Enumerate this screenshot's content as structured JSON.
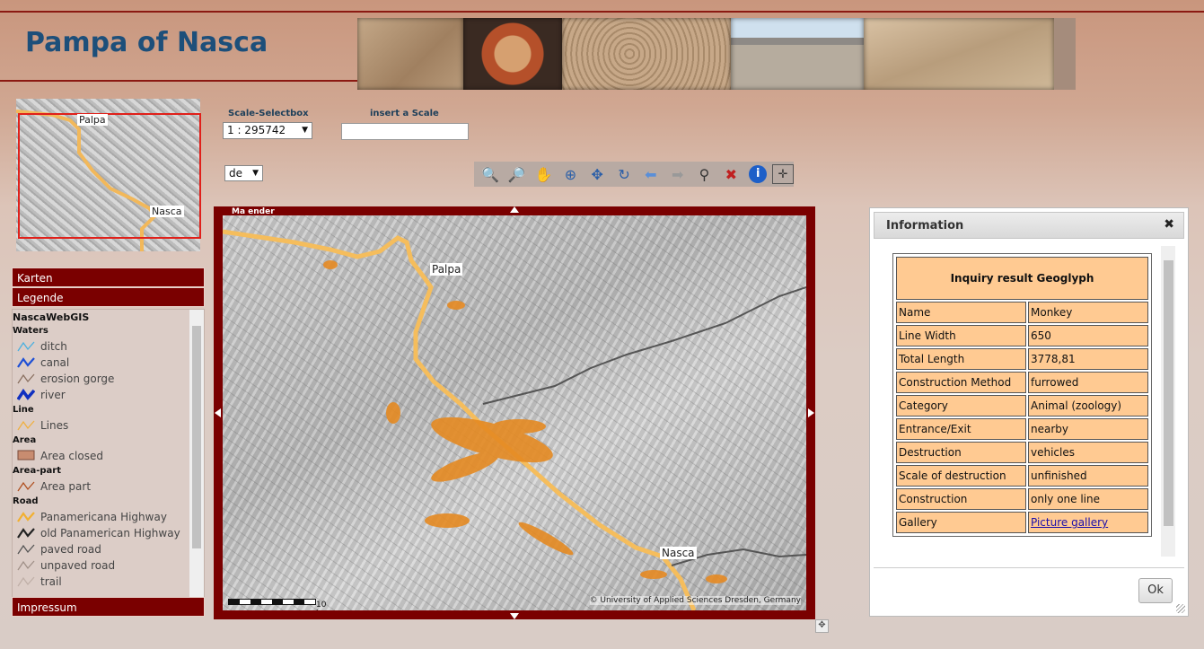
{
  "header": {
    "title": "Pampa of Nasca"
  },
  "banner": {
    "images": [
      "geoglyph-astronaut",
      "nasca-pottery",
      "geoglyph-monkey-spiral",
      "pampa-landscape",
      "geoglyph-aerial"
    ]
  },
  "overview": {
    "labels": [
      "Palpa",
      "Nasca"
    ]
  },
  "panels": {
    "karten": "Karten",
    "legende": "Legende",
    "impressum": "Impressum"
  },
  "legend": {
    "root": "NascaWebGIS",
    "groups": [
      {
        "title": "Waters",
        "items": [
          {
            "label": "ditch",
            "color": "#4ab0e0"
          },
          {
            "label": "canal",
            "color": "#1d4fd6"
          },
          {
            "label": "erosion gorge",
            "color": "#8a7060"
          },
          {
            "label": "river",
            "color": "#1030c0"
          }
        ]
      },
      {
        "title": "Line",
        "items": [
          {
            "label": "Lines",
            "color": "#f0b040"
          }
        ]
      },
      {
        "title": "Area",
        "items": [
          {
            "label": "Area closed",
            "color": "#c88c70"
          }
        ]
      },
      {
        "title": "Area-part",
        "items": [
          {
            "label": "Area part",
            "color": "#b05020"
          }
        ]
      },
      {
        "title": "Road",
        "items": [
          {
            "label": "Panamericana Highway",
            "color": "#f2b030"
          },
          {
            "label": "old Panamerican Highway",
            "color": "#222222"
          },
          {
            "label": "paved road",
            "color": "#555555"
          },
          {
            "label": "unpaved road",
            "color": "#a09088"
          },
          {
            "label": "trail",
            "color": "#c0b0a8"
          }
        ]
      }
    ]
  },
  "controls": {
    "scale_select_label": "Scale-Selectbox",
    "scale_value": "1 : 295742",
    "insert_scale_label": "insert a Scale",
    "insert_scale_value": "",
    "language_value": "de"
  },
  "toolbar": {
    "tools": [
      "zoom-in-icon",
      "zoom-out-icon",
      "pan-hand-icon",
      "zoom-extent-icon",
      "move-icon",
      "refresh-icon",
      "back-arrow-icon",
      "forward-arrow-icon",
      "select-icon",
      "clear-icon",
      "info-icon",
      "fullextent-icon"
    ]
  },
  "map": {
    "logo": "Ma  ender",
    "labels": {
      "palpa": "Palpa",
      "nasca": "Nasca"
    },
    "scalebar_label": "10 km",
    "copyright": "© University of Applied Sciences Dresden, Germany"
  },
  "info_dialog": {
    "title": "Information",
    "close": "✖",
    "heading": "Inquiry result Geoglyph",
    "rows": [
      {
        "key": "Name",
        "value": "Monkey"
      },
      {
        "key": "Line Width",
        "value": "650"
      },
      {
        "key": "Total Length",
        "value": "3778,81"
      },
      {
        "key": "Construction Method",
        "value": "furrowed"
      },
      {
        "key": "Category",
        "value": "Animal (zoology)"
      },
      {
        "key": "Entrance/Exit",
        "value": "nearby"
      },
      {
        "key": "Destruction",
        "value": "vehicles"
      },
      {
        "key": "Scale of destruction",
        "value": "unfinished"
      },
      {
        "key": "Construction",
        "value": "only one line"
      },
      {
        "key": "Gallery",
        "value": "Picture gallery"
      }
    ],
    "ok": "Ok"
  }
}
